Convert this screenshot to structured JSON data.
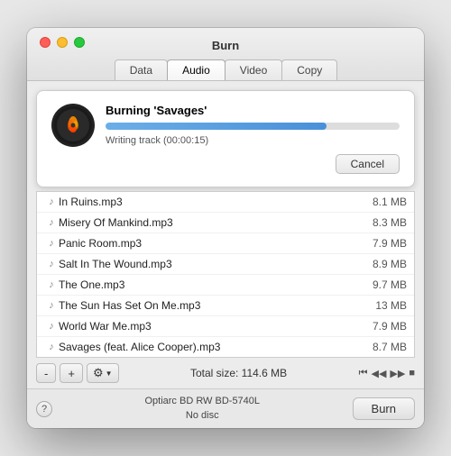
{
  "window": {
    "title": "Burn"
  },
  "tabs": [
    {
      "label": "Data",
      "active": false
    },
    {
      "label": "Audio",
      "active": true
    },
    {
      "label": "Video",
      "active": false
    },
    {
      "label": "Copy",
      "active": false
    }
  ],
  "progress": {
    "title": "Burning 'Savages'",
    "status": "Writing track (00:00:15)",
    "percent": 75,
    "cancel_label": "Cancel"
  },
  "files": [
    {
      "name": "In Ruins.mp3",
      "size": "8.1 MB"
    },
    {
      "name": "Misery Of Mankind.mp3",
      "size": "8.3 MB"
    },
    {
      "name": "Panic Room.mp3",
      "size": "7.9 MB"
    },
    {
      "name": "Salt In The Wound.mp3",
      "size": "8.9 MB"
    },
    {
      "name": "The One.mp3",
      "size": "9.7 MB"
    },
    {
      "name": "The Sun Has Set On Me.mp3",
      "size": "13 MB"
    },
    {
      "name": "World War Me.mp3",
      "size": "7.9 MB"
    },
    {
      "name": "Savages (feat. Alice Cooper).mp3",
      "size": "8.7 MB"
    }
  ],
  "toolbar": {
    "minus_label": "-",
    "plus_label": "+",
    "total_size_label": "Total size: 114.6 MB"
  },
  "footer": {
    "help_label": "?",
    "disc_name": "Optiarc BD RW BD-5740L",
    "disc_status": "No disc",
    "burn_label": "Burn"
  }
}
